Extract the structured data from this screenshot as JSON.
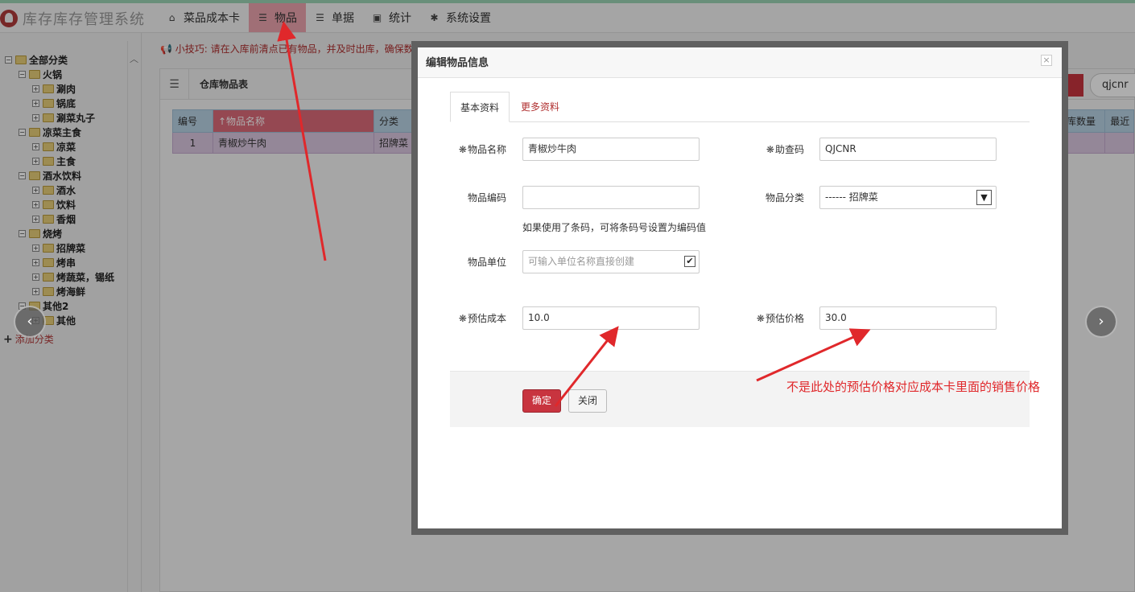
{
  "app": {
    "title": "库存库存管理系统"
  },
  "nav": [
    {
      "icon": "home-icon",
      "label": "菜品成本卡"
    },
    {
      "icon": "list-icon",
      "label": "物品"
    },
    {
      "icon": "list-icon",
      "label": "单据"
    },
    {
      "icon": "image-icon",
      "label": "统计"
    },
    {
      "icon": "gear-icon",
      "label": "系统设置"
    }
  ],
  "sidebar": {
    "tree": [
      {
        "level": 0,
        "label": "全部分类"
      },
      {
        "level": 1,
        "label": "火锅"
      },
      {
        "level": 2,
        "label": "涮肉"
      },
      {
        "level": 2,
        "label": "锅底"
      },
      {
        "level": 2,
        "label": "涮菜丸子"
      },
      {
        "level": 1,
        "label": "凉菜主食"
      },
      {
        "level": 2,
        "label": "凉菜"
      },
      {
        "level": 2,
        "label": "主食"
      },
      {
        "level": 1,
        "label": "酒水饮料"
      },
      {
        "level": 2,
        "label": "酒水"
      },
      {
        "level": 2,
        "label": "饮料"
      },
      {
        "level": 2,
        "label": "香烟"
      },
      {
        "level": 1,
        "label": "烧烤"
      },
      {
        "level": 2,
        "label": "招牌菜"
      },
      {
        "level": 2,
        "label": "烤串"
      },
      {
        "level": 2,
        "label": "烤蔬菜，锡纸"
      },
      {
        "level": 2,
        "label": "烤海鲜"
      },
      {
        "level": 1,
        "label": "其他2"
      },
      {
        "level": 2,
        "label": "其他"
      }
    ],
    "add_category": "添加分类"
  },
  "main": {
    "tip": "小技巧: 请在入库前清点已有物品，并及时出库，确保数量准确",
    "panel_title": "仓库物品表",
    "search_value": "qjcnr",
    "table": {
      "headers": [
        "编号",
        "↑物品名称",
        "分类"
      ],
      "headers_right": [
        "入库数量",
        "最近"
      ],
      "rows": [
        [
          "1",
          "青椒炒牛肉",
          "招牌菜"
        ]
      ]
    }
  },
  "modal": {
    "title": "编辑物品信息",
    "close": "×",
    "tabs": [
      "基本资料",
      "更多资料"
    ],
    "fields": {
      "name_label": "物品名称",
      "name_value": "青椒炒牛肉",
      "code_label": "助查码",
      "code_value": "QJCNR",
      "barcode_label": "物品编码",
      "barcode_value": "",
      "category_label": "物品分类",
      "category_value": "------ 招牌菜",
      "barcode_hint": "如果使用了条码，可将条码号设置为编码值",
      "unit_label": "物品单位",
      "unit_placeholder": "可输入单位名称直接创建",
      "cost_label": "预估成本",
      "cost_value": "10.0",
      "price_label": "预估价格",
      "price_value": "30.0"
    },
    "buttons": {
      "ok": "确定",
      "close": "关闭"
    }
  },
  "annotation": "不是此处的预估价格对应成本卡里面的销售价格",
  "colors": {
    "accent": "#c8343f",
    "annotation": "#e0282b",
    "nav_active": "#eca4ae"
  }
}
